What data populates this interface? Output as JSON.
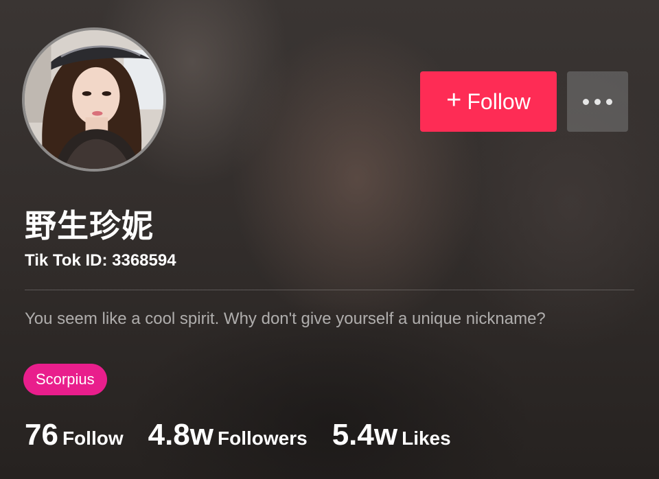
{
  "profile": {
    "display_name": "野生珍妮",
    "tiktok_id": "Tik Tok ID: 3368594",
    "bio": "You seem like a cool spirit. Why don't give yourself a unique nickname?",
    "tag": "Scorpius",
    "avatar_icon": "profile-photo"
  },
  "actions": {
    "follow_plus": "+",
    "follow_label": "Follow",
    "more_icon": "more-dots-icon"
  },
  "stats": {
    "following_count": "76",
    "following_label": "Follow",
    "followers_count": "4.8w",
    "followers_label": "Followers",
    "likes_count": "5.4w",
    "likes_label": "Likes"
  },
  "colors": {
    "follow_button": "#fe2c55",
    "tag_background": "#e91e8c",
    "more_button": "#787878"
  }
}
